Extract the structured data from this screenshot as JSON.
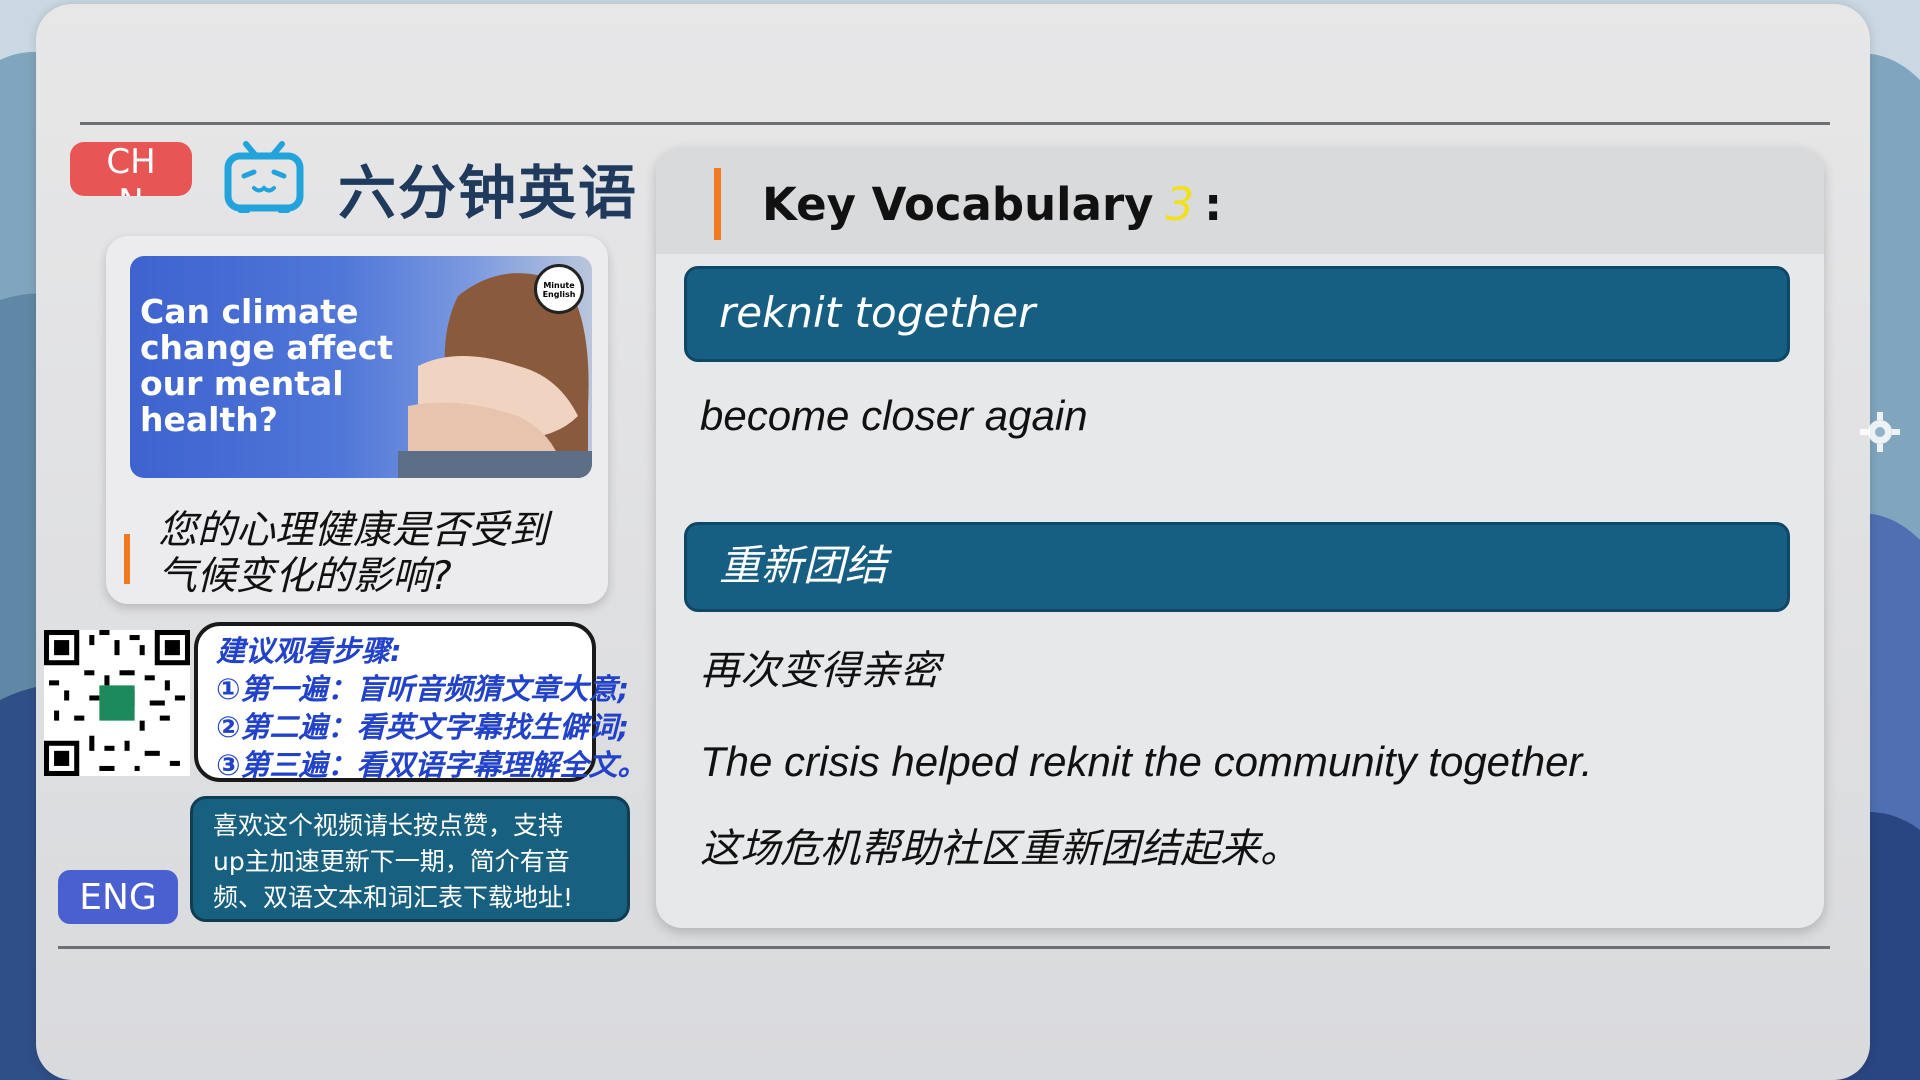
{
  "header": {
    "chn_badge": "CHN",
    "brand_title": "六分钟英语"
  },
  "thumbnail": {
    "title": "Can climate change affect our mental health?",
    "logo_text": "Minute English"
  },
  "question_cn": "您的心理健康是否受到气候变化的影响?",
  "steps": {
    "title": "建议观看步骤:",
    "items": [
      "①第一遍：盲听音频猜文章大意;",
      "②第二遍：看英文字幕找生僻词;",
      "③第三遍：看双语字幕理解全文。"
    ]
  },
  "support_text": [
    "喜欢这个视频请长按点赞，支持",
    "up主加速更新下一期，简介有音",
    "频、双语文本和词汇表下载地址!"
  ],
  "eng_badge": "ENG",
  "vocab": {
    "title": "Key Vocabulary",
    "number": "3",
    "colon": ":",
    "term": "reknit together",
    "definition": "become closer again",
    "term_cn": "重新团结",
    "definition_cn": "再次变得亲密",
    "example": "The crisis helped reknit the community together.",
    "example_cn": "这场危机帮助社区重新团结起来。"
  },
  "colors": {
    "accent_orange": "#f07a22",
    "vocab_bar": "#175e83",
    "chn_badge": "#e85555",
    "eng_badge": "#4a5fd0",
    "steps_text": "#2243c9"
  }
}
